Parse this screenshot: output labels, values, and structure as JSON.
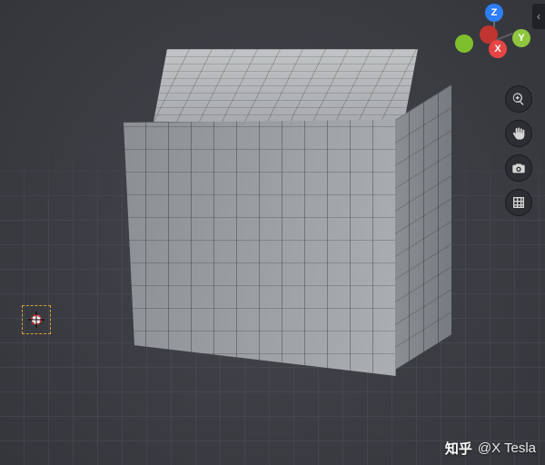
{
  "gizmo": {
    "axis_z": "Z",
    "axis_x": "X",
    "axis_y": "Y"
  },
  "toolbar": {
    "zoom_icon": "zoom",
    "pan_icon": "pan",
    "camera_icon": "camera",
    "grid_icon": "grid"
  },
  "expand_tab_glyph": "‹",
  "watermark": {
    "site": "知乎",
    "handle": "@X Tesla"
  }
}
